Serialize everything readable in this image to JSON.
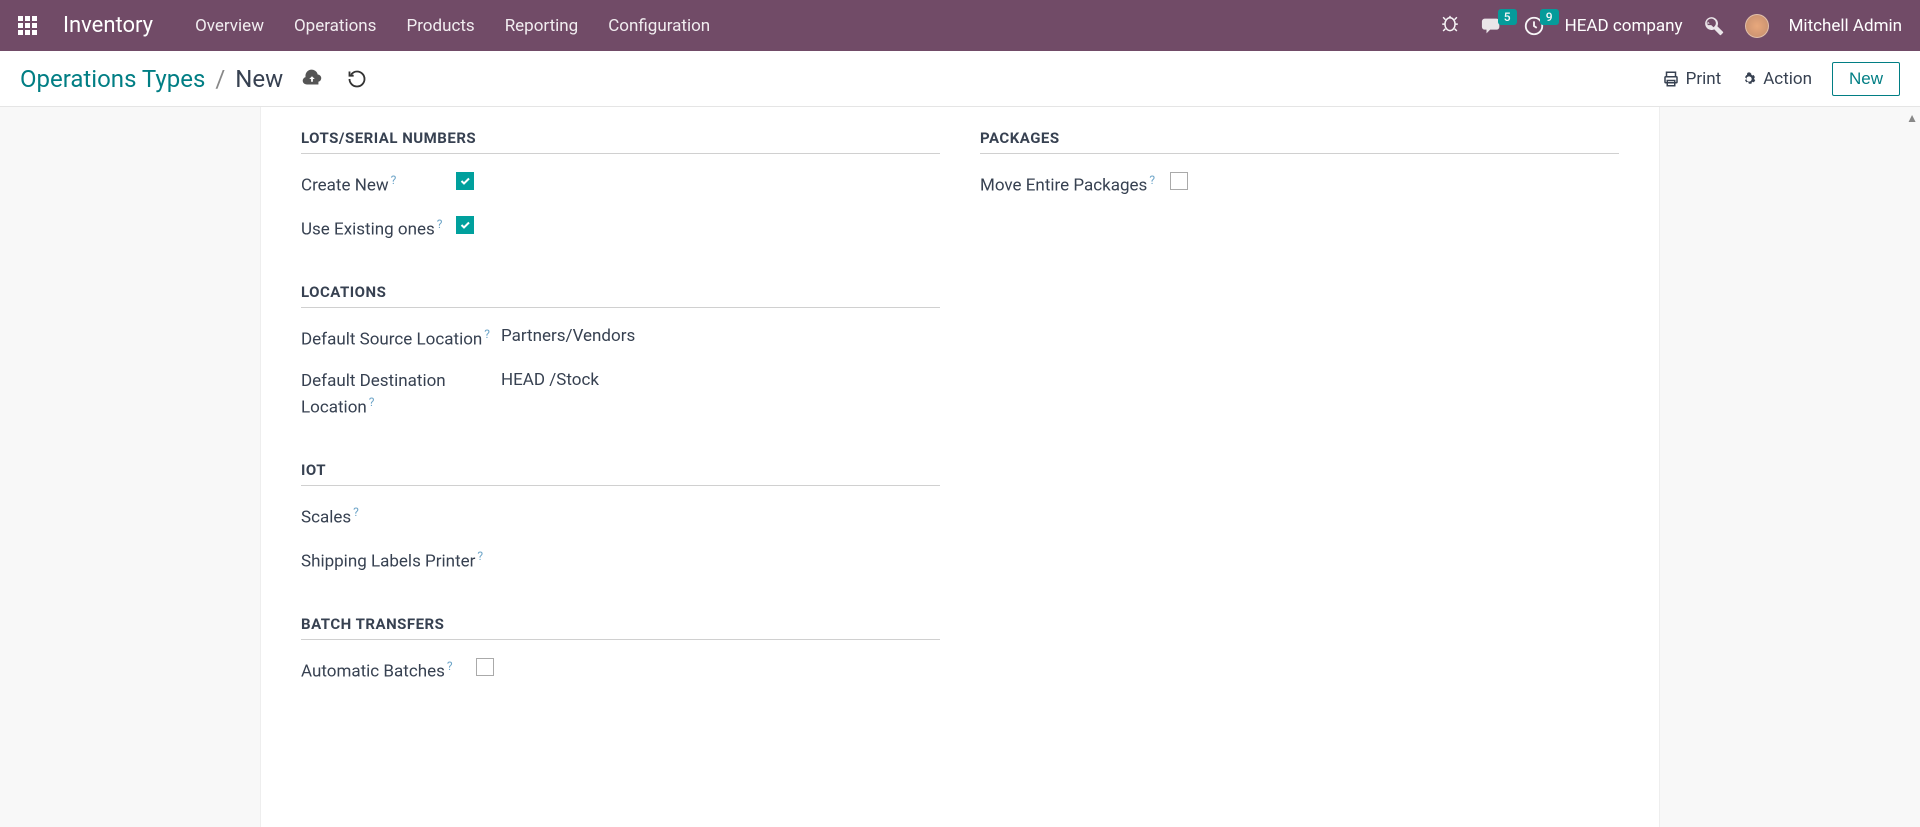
{
  "header": {
    "brand": "Inventory",
    "nav": [
      "Overview",
      "Operations",
      "Products",
      "Reporting",
      "Configuration"
    ],
    "messages_badge": "5",
    "activities_badge": "9",
    "company": "HEAD company",
    "user": "Mitchell Admin"
  },
  "subheader": {
    "breadcrumb_root": "Operations Types",
    "breadcrumb_current": "New",
    "print": "Print",
    "action": "Action",
    "new_button": "New"
  },
  "sections": {
    "lots": {
      "title": "LOTS/SERIAL NUMBERS",
      "create_new": "Create New",
      "use_existing": "Use Existing ones"
    },
    "packages": {
      "title": "PACKAGES",
      "move_entire": "Move Entire Packages"
    },
    "locations": {
      "title": "LOCATIONS",
      "source_label": "Default Source Location",
      "source_value": "Partners/Vendors",
      "dest_label": "Default Destination Location",
      "dest_value": "HEAD /Stock"
    },
    "iot": {
      "title": "IOT",
      "scales": "Scales",
      "printer": "Shipping Labels Printer"
    },
    "batch": {
      "title": "BATCH TRANSFERS",
      "auto": "Automatic Batches"
    }
  }
}
